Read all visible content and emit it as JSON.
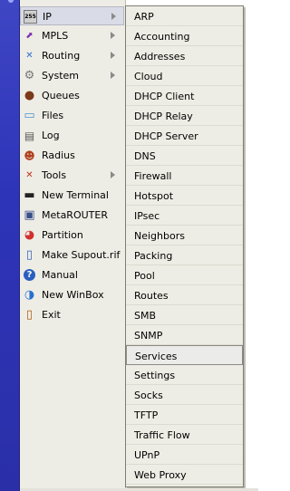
{
  "main_menu": {
    "items": [
      {
        "label": "IP",
        "icon": "ip-icon",
        "submenu": true
      },
      {
        "label": "MPLS",
        "icon": "mpls-icon",
        "submenu": true
      },
      {
        "label": "Routing",
        "icon": "routing-icon",
        "submenu": true
      },
      {
        "label": "System",
        "icon": "system-gear-icon",
        "submenu": true
      },
      {
        "label": "Queues",
        "icon": "queues-icon",
        "submenu": false
      },
      {
        "label": "Files",
        "icon": "folder-icon",
        "submenu": false
      },
      {
        "label": "Log",
        "icon": "log-icon",
        "submenu": false
      },
      {
        "label": "Radius",
        "icon": "radius-users-icon",
        "submenu": false
      },
      {
        "label": "Tools",
        "icon": "tools-icon",
        "submenu": true
      },
      {
        "label": "New Terminal",
        "icon": "terminal-icon",
        "submenu": false
      },
      {
        "label": "MetaROUTER",
        "icon": "metarouter-icon",
        "submenu": false
      },
      {
        "label": "Partition",
        "icon": "partition-pie-icon",
        "submenu": false
      },
      {
        "label": "Make Supout.rif",
        "icon": "supout-file-icon",
        "submenu": false
      },
      {
        "label": "Manual",
        "icon": "help-icon",
        "submenu": false
      },
      {
        "label": "New WinBox",
        "icon": "winbox-icon",
        "submenu": false
      },
      {
        "label": "Exit",
        "icon": "exit-door-icon",
        "submenu": false
      }
    ],
    "icon_glyphs": {
      "ip": "255",
      "mpls": "⬈",
      "routing": "✕",
      "system": "⚙",
      "queues": "●",
      "files": "▭",
      "log": "▤",
      "radius": "☻",
      "tools": "✕",
      "terminal": "▬",
      "metarouter": "▣",
      "partition": "◕",
      "supout": "▯",
      "manual": "?",
      "winbox": "◑",
      "exit": "▯"
    },
    "active_index": 0
  },
  "submenu": {
    "items": [
      "ARP",
      "Accounting",
      "Addresses",
      "Cloud",
      "DHCP Client",
      "DHCP Relay",
      "DHCP Server",
      "DNS",
      "Firewall",
      "Hotspot",
      "IPsec",
      "Neighbors",
      "Packing",
      "Pool",
      "Routes",
      "SMB",
      "SNMP",
      "Services",
      "Settings",
      "Socks",
      "TFTP",
      "Traffic Flow",
      "UPnP",
      "Web Proxy"
    ],
    "highlighted_index": 17
  },
  "colors": {
    "side_strip": "#2e34b8",
    "menu_bg": "#eeede5",
    "active_bg": "#d9dce6",
    "highlight_border": "#8c8b85"
  }
}
